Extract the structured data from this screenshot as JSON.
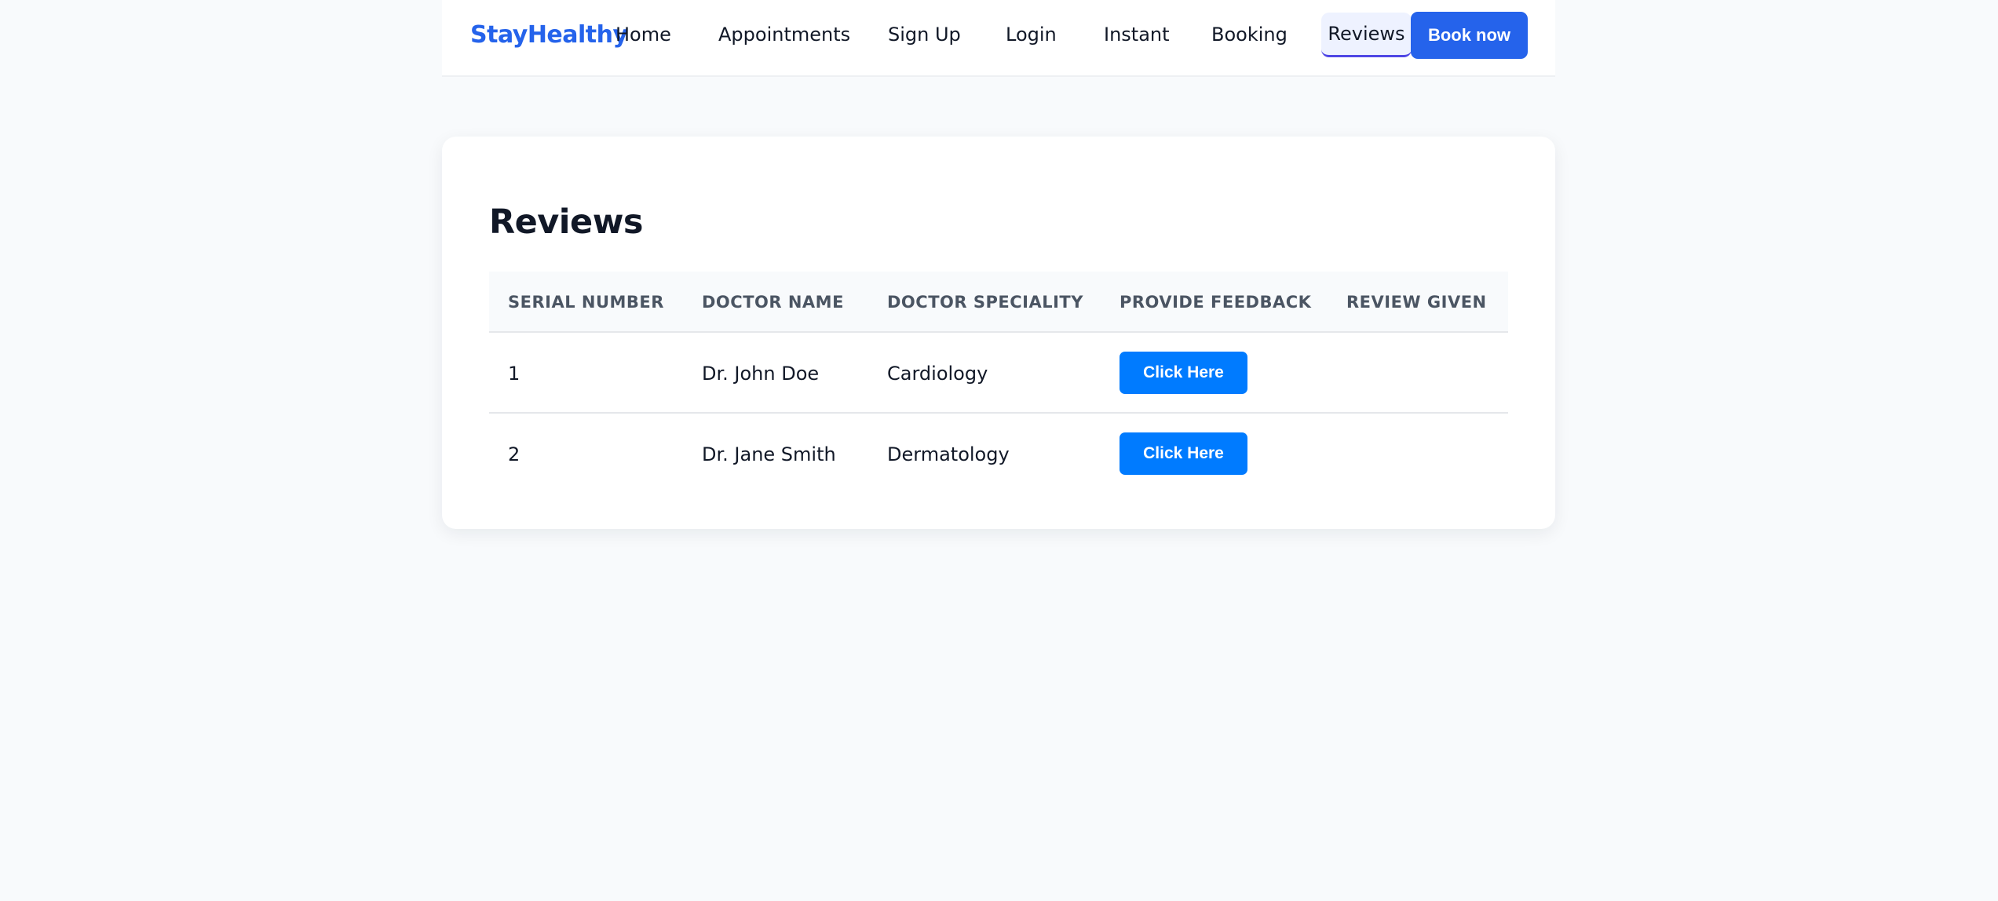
{
  "navbar": {
    "brand": "StayHealthy",
    "items": [
      "Home",
      "Appointments",
      "Sign Up",
      "Login",
      "Instant",
      "Booking"
    ],
    "active_item": "Reviews",
    "cta_label": "Book now",
    "accent_color": "#2563eb"
  },
  "reviews": {
    "title": "Reviews",
    "columns": [
      "SERIAL NUMBER",
      "DOCTOR NAME",
      "DOCTOR SPECIALITY",
      "PROVIDE FEEDBACK",
      "REVIEW GIVEN"
    ],
    "rows": [
      {
        "serial": "1",
        "doctor": "Dr. John Doe",
        "speciality": "Cardiology",
        "feedback_label": "Click Here",
        "review": ""
      },
      {
        "serial": "2",
        "doctor": "Dr. Jane Smith",
        "speciality": "Dermatology",
        "feedback_label": "Click Here",
        "review": ""
      }
    ],
    "button_color": "#007bff"
  }
}
